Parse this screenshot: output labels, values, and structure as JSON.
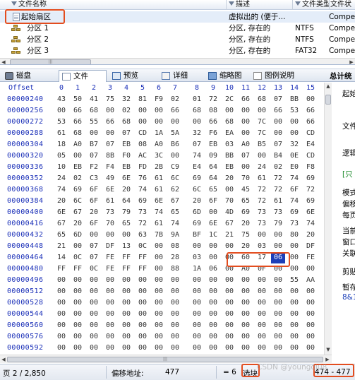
{
  "file_list": {
    "columns": [
      "文件名称",
      "描述",
      "文件类型",
      "文件状"
    ],
    "rows": [
      {
        "name": "起始扇区",
        "desc": "虚拟出的 (便于...",
        "type": "",
        "extra": "Compe",
        "icon": "document-icon",
        "selected": true
      },
      {
        "name": "分区 1",
        "desc": "分区, 存在的",
        "type": "NTFS",
        "extra": "Compe",
        "icon": "partition-icon",
        "selected": false
      },
      {
        "name": "分区 2",
        "desc": "分区, 存在的",
        "type": "NTFS",
        "extra": "Compe",
        "icon": "partition-icon",
        "selected": false
      },
      {
        "name": "分区 3",
        "desc": "分区, 存在的",
        "type": "FAT32",
        "extra": "Compe",
        "icon": "partition-icon",
        "selected": false
      }
    ]
  },
  "tabs": [
    {
      "label": "磁盘",
      "icon": "disk-icon",
      "active": false
    },
    {
      "label": "文件",
      "icon": "file-icon",
      "active": true
    },
    {
      "label": "预览",
      "icon": "preview-icon",
      "active": false
    },
    {
      "label": "详细",
      "icon": "details-icon",
      "active": false
    },
    {
      "label": "缩略图",
      "icon": "thumbnail-icon",
      "active": false
    },
    {
      "label": "图例说明",
      "icon": "legend-icon",
      "active": false
    }
  ],
  "side_title": "总计统",
  "hex": {
    "offset_label": "Offset",
    "columns": [
      "0",
      "1",
      "2",
      "3",
      "4",
      "5",
      "6",
      "7",
      "8",
      "9",
      "10",
      "11",
      "12",
      "13",
      "14",
      "15"
    ],
    "rows": [
      {
        "offset": "00000240",
        "bytes": [
          "43",
          "50",
          "41",
          "75",
          "32",
          "81",
          "F9",
          "02",
          "01",
          "72",
          "2C",
          "66",
          "68",
          "07",
          "BB",
          "00"
        ]
      },
      {
        "offset": "00000256",
        "bytes": [
          "00",
          "66",
          "68",
          "00",
          "02",
          "00",
          "00",
          "66",
          "68",
          "08",
          "00",
          "00",
          "00",
          "66",
          "53",
          "66"
        ]
      },
      {
        "offset": "00000272",
        "bytes": [
          "53",
          "66",
          "55",
          "66",
          "68",
          "00",
          "00",
          "00",
          "00",
          "66",
          "68",
          "00",
          "7C",
          "00",
          "00",
          "66"
        ]
      },
      {
        "offset": "00000288",
        "bytes": [
          "61",
          "68",
          "00",
          "00",
          "07",
          "CD",
          "1A",
          "5A",
          "32",
          "F6",
          "EA",
          "00",
          "7C",
          "00",
          "00",
          "CD"
        ]
      },
      {
        "offset": "00000304",
        "bytes": [
          "18",
          "A0",
          "B7",
          "07",
          "EB",
          "08",
          "A0",
          "B6",
          "07",
          "EB",
          "03",
          "A0",
          "B5",
          "07",
          "32",
          "E4"
        ]
      },
      {
        "offset": "00000320",
        "bytes": [
          "05",
          "00",
          "07",
          "8B",
          "F0",
          "AC",
          "3C",
          "00",
          "74",
          "09",
          "BB",
          "07",
          "00",
          "B4",
          "0E",
          "CD"
        ]
      },
      {
        "offset": "00000336",
        "bytes": [
          "10",
          "EB",
          "F2",
          "F4",
          "EB",
          "FD",
          "2B",
          "C9",
          "E4",
          "64",
          "EB",
          "00",
          "24",
          "02",
          "E0",
          "F8"
        ]
      },
      {
        "offset": "00000352",
        "bytes": [
          "24",
          "02",
          "C3",
          "49",
          "6E",
          "76",
          "61",
          "6C",
          "69",
          "64",
          "20",
          "70",
          "61",
          "72",
          "74",
          "69"
        ]
      },
      {
        "offset": "00000368",
        "bytes": [
          "74",
          "69",
          "6F",
          "6E",
          "20",
          "74",
          "61",
          "62",
          "6C",
          "65",
          "00",
          "45",
          "72",
          "72",
          "6F",
          "72"
        ]
      },
      {
        "offset": "00000384",
        "bytes": [
          "20",
          "6C",
          "6F",
          "61",
          "64",
          "69",
          "6E",
          "67",
          "20",
          "6F",
          "70",
          "65",
          "72",
          "61",
          "74",
          "69"
        ]
      },
      {
        "offset": "00000400",
        "bytes": [
          "6E",
          "67",
          "20",
          "73",
          "79",
          "73",
          "74",
          "65",
          "6D",
          "00",
          "4D",
          "69",
          "73",
          "73",
          "69",
          "6E"
        ]
      },
      {
        "offset": "00000416",
        "bytes": [
          "67",
          "20",
          "6F",
          "70",
          "65",
          "72",
          "61",
          "74",
          "69",
          "6E",
          "67",
          "20",
          "73",
          "79",
          "73",
          "74"
        ]
      },
      {
        "offset": "00000432",
        "bytes": [
          "65",
          "6D",
          "00",
          "00",
          "00",
          "63",
          "7B",
          "9A",
          "BF",
          "1C",
          "21",
          "75",
          "00",
          "00",
          "80",
          "20"
        ]
      },
      {
        "offset": "00000448",
        "bytes": [
          "21",
          "00",
          "07",
          "DF",
          "13",
          "0C",
          "00",
          "08",
          "00",
          "00",
          "00",
          "20",
          "03",
          "00",
          "00",
          "DF"
        ]
      },
      {
        "offset": "00000464",
        "bytes": [
          "14",
          "0C",
          "07",
          "FE",
          "FF",
          "FF",
          "00",
          "28",
          "03",
          "00",
          "00",
          "60",
          "17",
          "06",
          "00",
          "FE"
        ]
      },
      {
        "offset": "00000480",
        "bytes": [
          "FF",
          "FF",
          "0C",
          "FE",
          "FF",
          "FF",
          "00",
          "88",
          "1A",
          "06",
          "00",
          "A0",
          "0F",
          "00",
          "00",
          "00"
        ]
      },
      {
        "offset": "00000496",
        "bytes": [
          "00",
          "00",
          "00",
          "00",
          "00",
          "00",
          "00",
          "00",
          "00",
          "00",
          "00",
          "00",
          "00",
          "00",
          "55",
          "AA"
        ]
      },
      {
        "offset": "00000512",
        "bytes": [
          "00",
          "00",
          "00",
          "00",
          "00",
          "00",
          "00",
          "00",
          "00",
          "00",
          "00",
          "00",
          "00",
          "00",
          "00",
          "00"
        ]
      },
      {
        "offset": "00000528",
        "bytes": [
          "00",
          "00",
          "00",
          "00",
          "00",
          "00",
          "00",
          "00",
          "00",
          "00",
          "00",
          "00",
          "00",
          "00",
          "00",
          "00"
        ]
      },
      {
        "offset": "00000544",
        "bytes": [
          "00",
          "00",
          "00",
          "00",
          "00",
          "00",
          "00",
          "00",
          "00",
          "00",
          "00",
          "00",
          "00",
          "00",
          "00",
          "00"
        ]
      },
      {
        "offset": "00000560",
        "bytes": [
          "00",
          "00",
          "00",
          "00",
          "00",
          "00",
          "00",
          "00",
          "00",
          "00",
          "00",
          "00",
          "00",
          "00",
          "00",
          "00"
        ]
      },
      {
        "offset": "00000576",
        "bytes": [
          "00",
          "00",
          "00",
          "00",
          "00",
          "00",
          "00",
          "00",
          "00",
          "00",
          "00",
          "00",
          "00",
          "00",
          "00",
          "00"
        ]
      },
      {
        "offset": "00000592",
        "bytes": [
          "00",
          "00",
          "00",
          "00",
          "00",
          "00",
          "00",
          "00",
          "00",
          "00",
          "00",
          "00",
          "00",
          "00",
          "00",
          "00"
        ]
      }
    ],
    "selected_byte": {
      "row": 14,
      "col": 13
    }
  },
  "info_panel": {
    "items": [
      {
        "text": "起始",
        "style": "normal"
      },
      {
        "text": "文件",
        "style": "normal"
      },
      {
        "text": "逻辑",
        "style": "normal"
      },
      {
        "text": "[只",
        "style": "green"
      },
      {
        "text": "模式",
        "style": "normal"
      },
      {
        "text": "偏移",
        "style": "normal"
      },
      {
        "text": "每页",
        "style": "normal"
      },
      {
        "text": "当前",
        "style": "normal"
      },
      {
        "text": "窗口",
        "style": "normal"
      },
      {
        "text": "关联",
        "style": "normal"
      },
      {
        "text": "剪贴",
        "style": "normal"
      },
      {
        "text": "暂存",
        "style": "normal"
      },
      {
        "text": "8&1",
        "style": "blue"
      }
    ]
  },
  "status_bar": {
    "page": "页 2 / 2,850",
    "offset_label": "偏移地址:",
    "offset_value": "477",
    "value": "= 6",
    "block_label": "选块:",
    "block_value": "474 - 477"
  },
  "watermark": "CSDN @youngqi08",
  "colors": {
    "highlight_box": "#e34d1f",
    "offset_blue": "#1a2fb8",
    "selection": "#1d3fb8"
  }
}
